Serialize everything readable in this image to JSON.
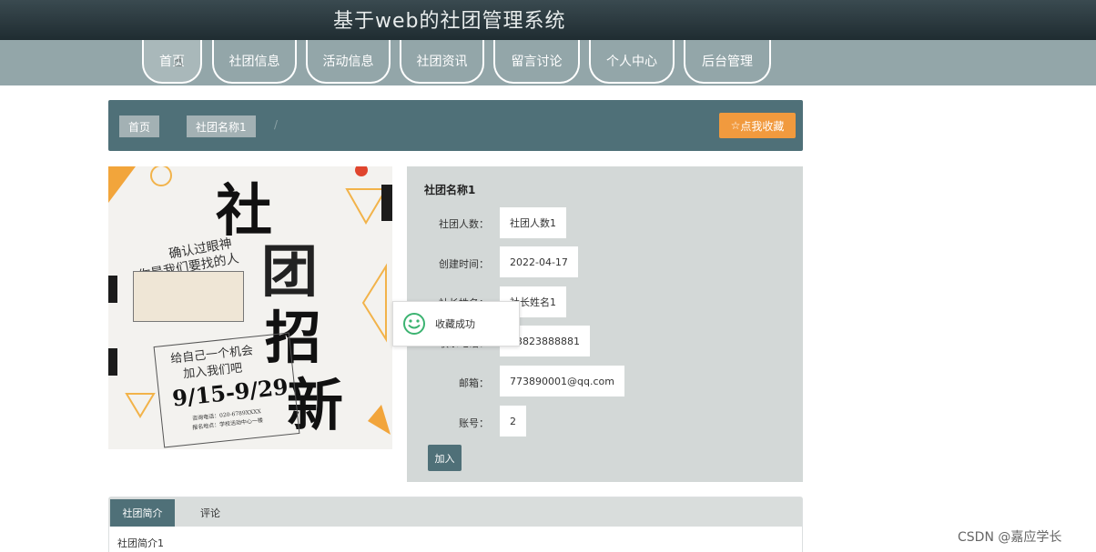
{
  "header": {
    "title": "基于web的社团管理系统"
  },
  "nav": {
    "items": [
      {
        "label": "首页"
      },
      {
        "label": "社团信息"
      },
      {
        "label": "活动信息"
      },
      {
        "label": "社团资讯"
      },
      {
        "label": "留言讨论"
      },
      {
        "label": "个人中心"
      },
      {
        "label": "后台管理"
      }
    ]
  },
  "breadcrumb": {
    "home": "首页",
    "separator": "/",
    "current": "社团名称1"
  },
  "favorite_button": {
    "label": "点我收藏",
    "icon": "star-icon"
  },
  "poster": {
    "headline_chars": [
      "社",
      "团",
      "招",
      "新"
    ],
    "line1": "确认过眼神",
    "line2": "你是我们要找的人",
    "line3": "给自己一个机会",
    "line4": "加入我们吧",
    "dates": "9/15-9/29",
    "fine1": "咨询电话：020-6789XXXX",
    "fine2": "报名地点：学校活动中心一楼"
  },
  "detail": {
    "title": "社团名称1",
    "rows": [
      {
        "label": "社团人数：",
        "value": "社团人数1"
      },
      {
        "label": "创建时间：",
        "value": "2022-04-17"
      },
      {
        "label": "社长姓名：",
        "value": "社长姓名1"
      },
      {
        "label": "联系电话：",
        "value": "13823888881"
      },
      {
        "label": "邮箱：",
        "value": "773890001@qq.com"
      },
      {
        "label": "账号：",
        "value": "2"
      }
    ],
    "join_button": "加入"
  },
  "toast": {
    "text": "收藏成功",
    "icon": "smile-icon",
    "color": "#3cb371"
  },
  "tabs": {
    "items": [
      {
        "label": "社团简介"
      },
      {
        "label": "评论"
      }
    ],
    "content": "社团简介1"
  },
  "watermark": "CSDN @嘉应学长",
  "colors": {
    "header": "#1f2c31",
    "nav": "#93a6a9",
    "accent": "#4f7078",
    "orange": "#f19a3e",
    "panel": "#d3d8d7"
  }
}
